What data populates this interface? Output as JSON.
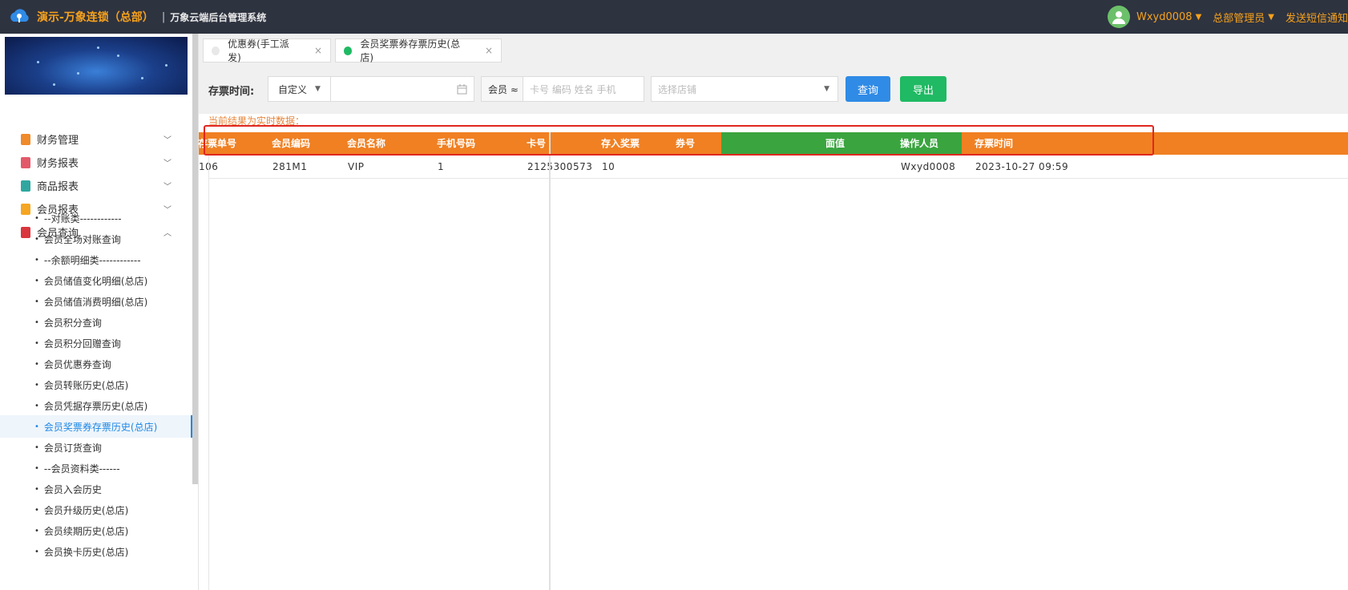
{
  "header": {
    "brand": "演示-万象连锁（总部）",
    "separator": "|",
    "system_name": "万象云端后台管理系统",
    "user": "Wxyd0008",
    "role": "总部管理员",
    "notify": "发送短信通知"
  },
  "sidebar": {
    "groups": [
      {
        "label": "财务管理",
        "color": "#f08a2a",
        "expanded": false
      },
      {
        "label": "财务报表",
        "color": "#e25a6a",
        "expanded": false
      },
      {
        "label": "商品报表",
        "color": "#2fa7a0",
        "expanded": false
      },
      {
        "label": "会员报表",
        "color": "#f5a623",
        "expanded": false
      },
      {
        "label": "会员查询",
        "color": "#d9363e",
        "expanded": true
      }
    ],
    "items": [
      "--对账类------------",
      "会员全场对账查询",
      "--余额明细类------------",
      "会员储值变化明细(总店)",
      "会员储值消费明细(总店)",
      "会员积分查询",
      "会员积分回赠查询",
      "会员优惠券查询",
      "会员转账历史(总店)",
      "会员凭据存票历史(总店)",
      "会员奖票券存票历史(总店)",
      "会员订货查询",
      "--会员资料类------",
      "会员入会历史",
      "会员升级历史(总店)",
      "会员续期历史(总店)",
      "会员换卡历史(总店)"
    ],
    "active_index": 10
  },
  "tabs": [
    {
      "label": "优惠券(手工派发)",
      "active": false,
      "close": "×"
    },
    {
      "label": "会员奖票券存票历史(总店)",
      "active": true,
      "close": "×"
    }
  ],
  "filter": {
    "label": "存票时间:",
    "date_mode": "自定义",
    "date_value": "",
    "member_mode": "会员 ≈",
    "member_placeholder": "卡号 编码 姓名 手机",
    "store_placeholder": "选择店铺",
    "query_button": "查询",
    "export_button": "导出"
  },
  "note": "当前结果为实时数据：",
  "table": {
    "headers": [
      "存票单号",
      "会员编码",
      "会员名称",
      "手机号码",
      "卡号",
      "存入奖票",
      "券号",
      "面值",
      "操作人员",
      "存票时间"
    ],
    "rows": [
      [
        "106",
        "281M1",
        "VIP",
        "1",
        "2125300573",
        "10",
        "",
        "",
        "Wxyd0008",
        "2023-10-27 09:59"
      ]
    ]
  },
  "colors": {
    "topbar": "#2e3340",
    "accent": "#f7a21b",
    "header_orange": "#f08022",
    "header_green": "#3aa43f",
    "query_blue": "#2f8be6",
    "export_green": "#1fba63",
    "highlight_red": "#e0271f"
  }
}
